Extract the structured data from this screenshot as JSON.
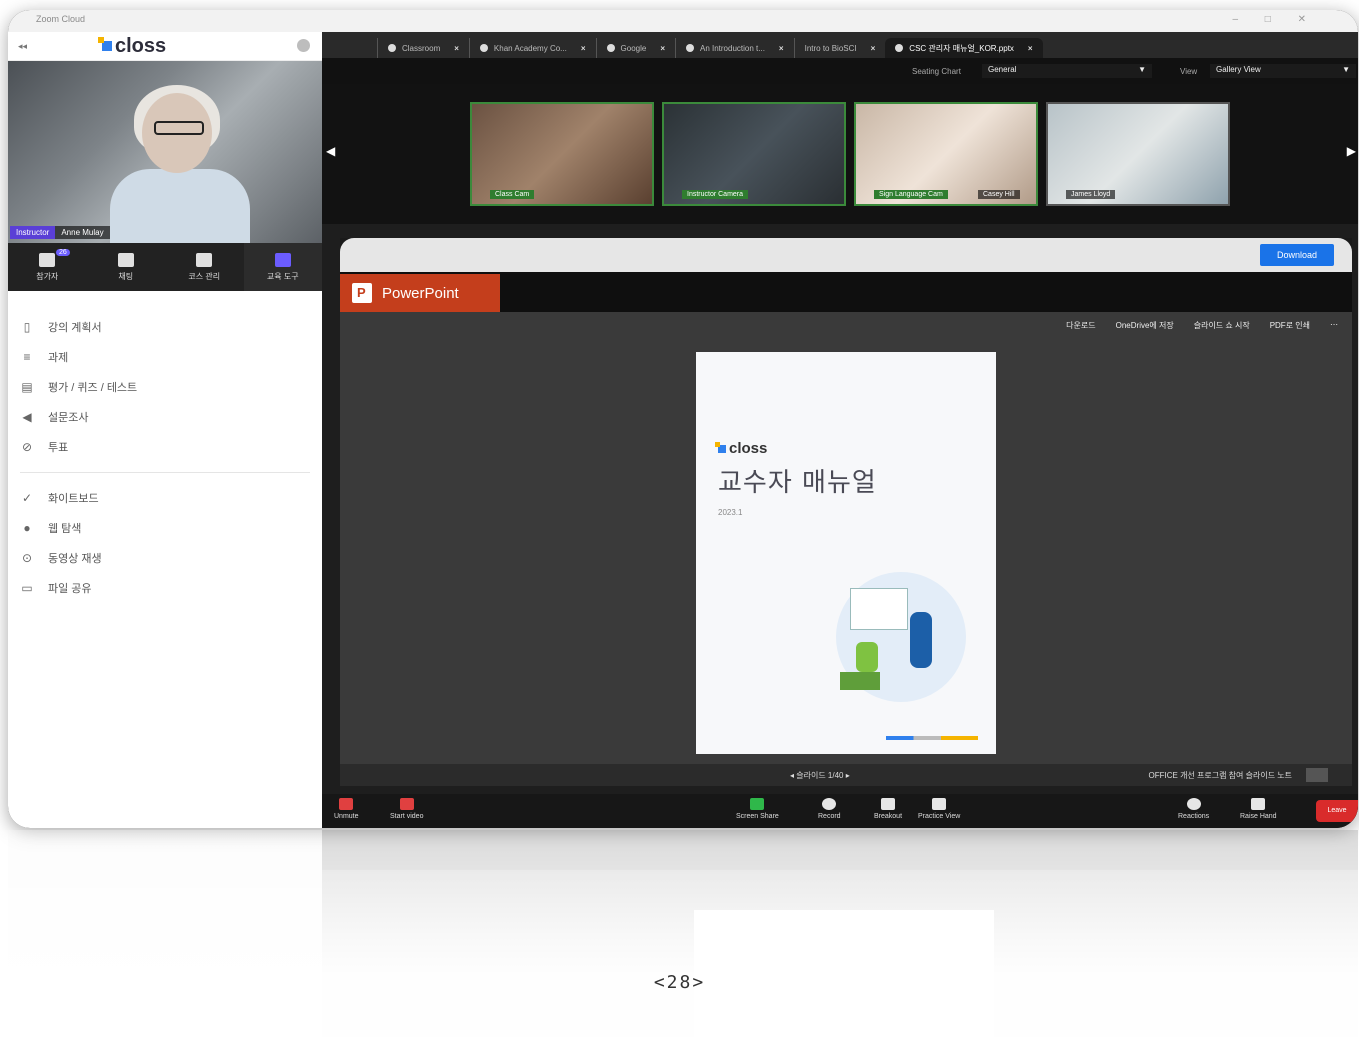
{
  "window": {
    "title": "Zoom Cloud",
    "controls": "– □ ✕"
  },
  "sidebar": {
    "logo": "closs",
    "instructor_role": "Instructor",
    "instructor_name": "Anne Mulay",
    "tabs": [
      {
        "label": "참가자",
        "badge": "26",
        "icon": "participants-icon"
      },
      {
        "label": "채팅",
        "icon": "chat-icon"
      },
      {
        "label": "코스 관리",
        "icon": "course-icon"
      },
      {
        "label": "교육 도구",
        "icon": "tools-icon"
      }
    ],
    "menu": [
      {
        "label": "강의 계획서",
        "icon": "document-icon"
      },
      {
        "label": "과제",
        "icon": "task-icon"
      },
      {
        "label": "평가 / 퀴즈 / 테스트",
        "icon": "quiz-icon"
      },
      {
        "label": "설문조사",
        "icon": "survey-icon"
      },
      {
        "label": "투표",
        "icon": "vote-icon"
      }
    ],
    "menu2": [
      {
        "label": "화이트보드",
        "icon": "whiteboard-icon"
      },
      {
        "label": "웹 탐색",
        "icon": "globe-icon"
      },
      {
        "label": "동영상 재생",
        "icon": "play-icon"
      },
      {
        "label": "파일 공유",
        "icon": "folder-icon"
      }
    ]
  },
  "browser_tabs": [
    {
      "label": "Classroom",
      "active": false
    },
    {
      "label": "Khan Academy Co...",
      "active": false
    },
    {
      "label": "Google",
      "active": false
    },
    {
      "label": "An Introduction t...",
      "active": false
    },
    {
      "label": "Intro to BioSCI",
      "active": false
    },
    {
      "label": "CSC 관리자 매뉴얼_KOR.pptx",
      "active": true
    }
  ],
  "zoom_top": {
    "seating_label": "Seating Chart",
    "seating_value": "General",
    "view_label": "View",
    "view_value": "Gallery View"
  },
  "gallery": [
    {
      "label": "Class Cam",
      "extra": ""
    },
    {
      "label": "Instructor Camera",
      "extra": ""
    },
    {
      "label": "Sign Language Cam",
      "extra": "Casey Hill"
    },
    {
      "label": "James Lloyd",
      "extra": ""
    }
  ],
  "share": {
    "download_label": "Download",
    "app_name": "PowerPoint",
    "toolbar": [
      "다운로드",
      "OneDrive에 저장",
      "슬라이드 쇼 시작",
      "PDF로 인쇄",
      "⋯"
    ],
    "slide": {
      "logo": "closs",
      "title": "교수자 매뉴얼",
      "year": "2023.1"
    },
    "status_center": "슬라이드 1/40",
    "status_right": "OFFICE 개선 프로그램 참여   슬라이드 노트"
  },
  "controls": [
    {
      "label": "Unmute",
      "icon": "mic-muted-icon"
    },
    {
      "label": "Start video",
      "icon": "video-off-icon"
    },
    {
      "label": "Screen Share",
      "icon": "screen-share-icon"
    },
    {
      "label": "Record",
      "icon": "record-icon"
    },
    {
      "label": "Breakout",
      "icon": "breakout-icon"
    },
    {
      "label": "Practice View",
      "icon": "practice-view-icon"
    },
    {
      "label": "Reactions",
      "icon": "reactions-icon"
    },
    {
      "label": "Raise Hand",
      "icon": "raise-hand-icon"
    }
  ],
  "leave_label": "Leave",
  "page_number": "<28>"
}
